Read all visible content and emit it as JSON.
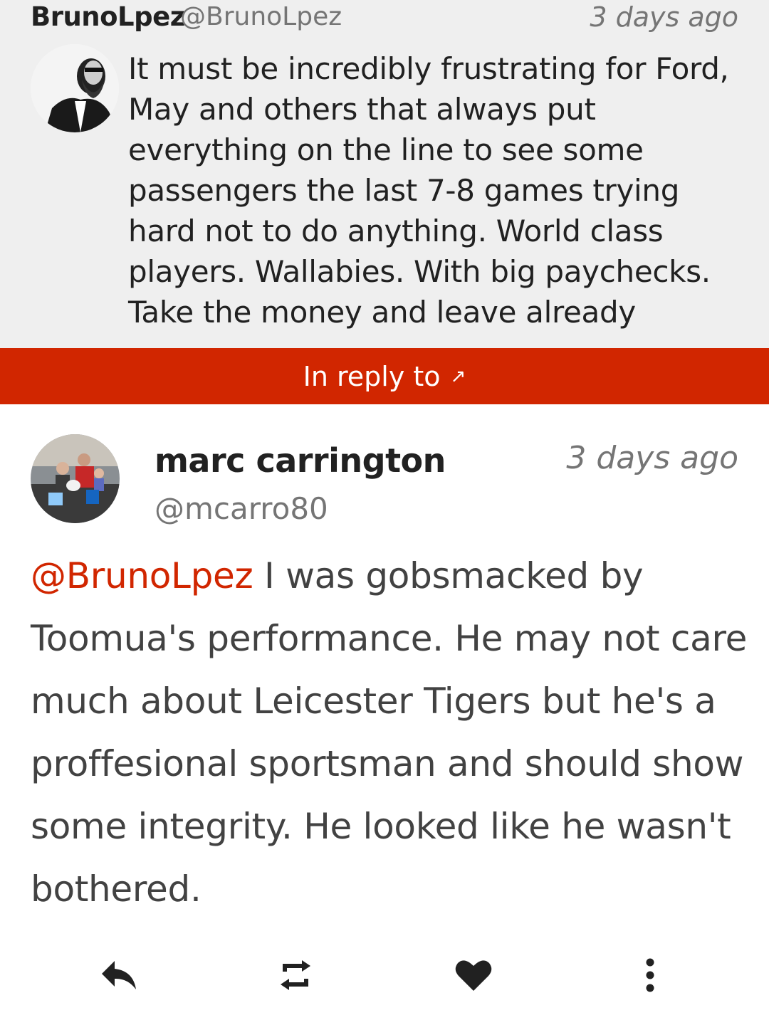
{
  "quoted": {
    "display_name": "BrunoLpez",
    "handle": "@BrunoLpez",
    "time": "3 days ago",
    "text": "It must be incredibly frustrating for Ford, May and others that always put everything on the line to see some passengers the last 7-8 games trying hard not to do anything. World class players. Wallabies. With big paychecks. Take the money and leave already"
  },
  "reply_bar": {
    "label": "In reply to",
    "icon": "arrow-up-right-icon",
    "color": "#d12600"
  },
  "tweet": {
    "display_name": "marc carrington",
    "handle": "@mcarro80",
    "time": "3 days ago",
    "mention": "@BrunoLpez",
    "text": " I was gobsmacked by Toomua's performance. He may not care much about Leicester Tigers but he's a proffesional sportsman and should show some integrity. He looked like he wasn't bothered.",
    "mention_color": "#d12600"
  },
  "actions": [
    {
      "name": "reply",
      "icon": "reply-icon"
    },
    {
      "name": "retweet",
      "icon": "retweet-icon"
    },
    {
      "name": "like",
      "icon": "heart-icon"
    },
    {
      "name": "more",
      "icon": "more-vertical-icon"
    }
  ]
}
